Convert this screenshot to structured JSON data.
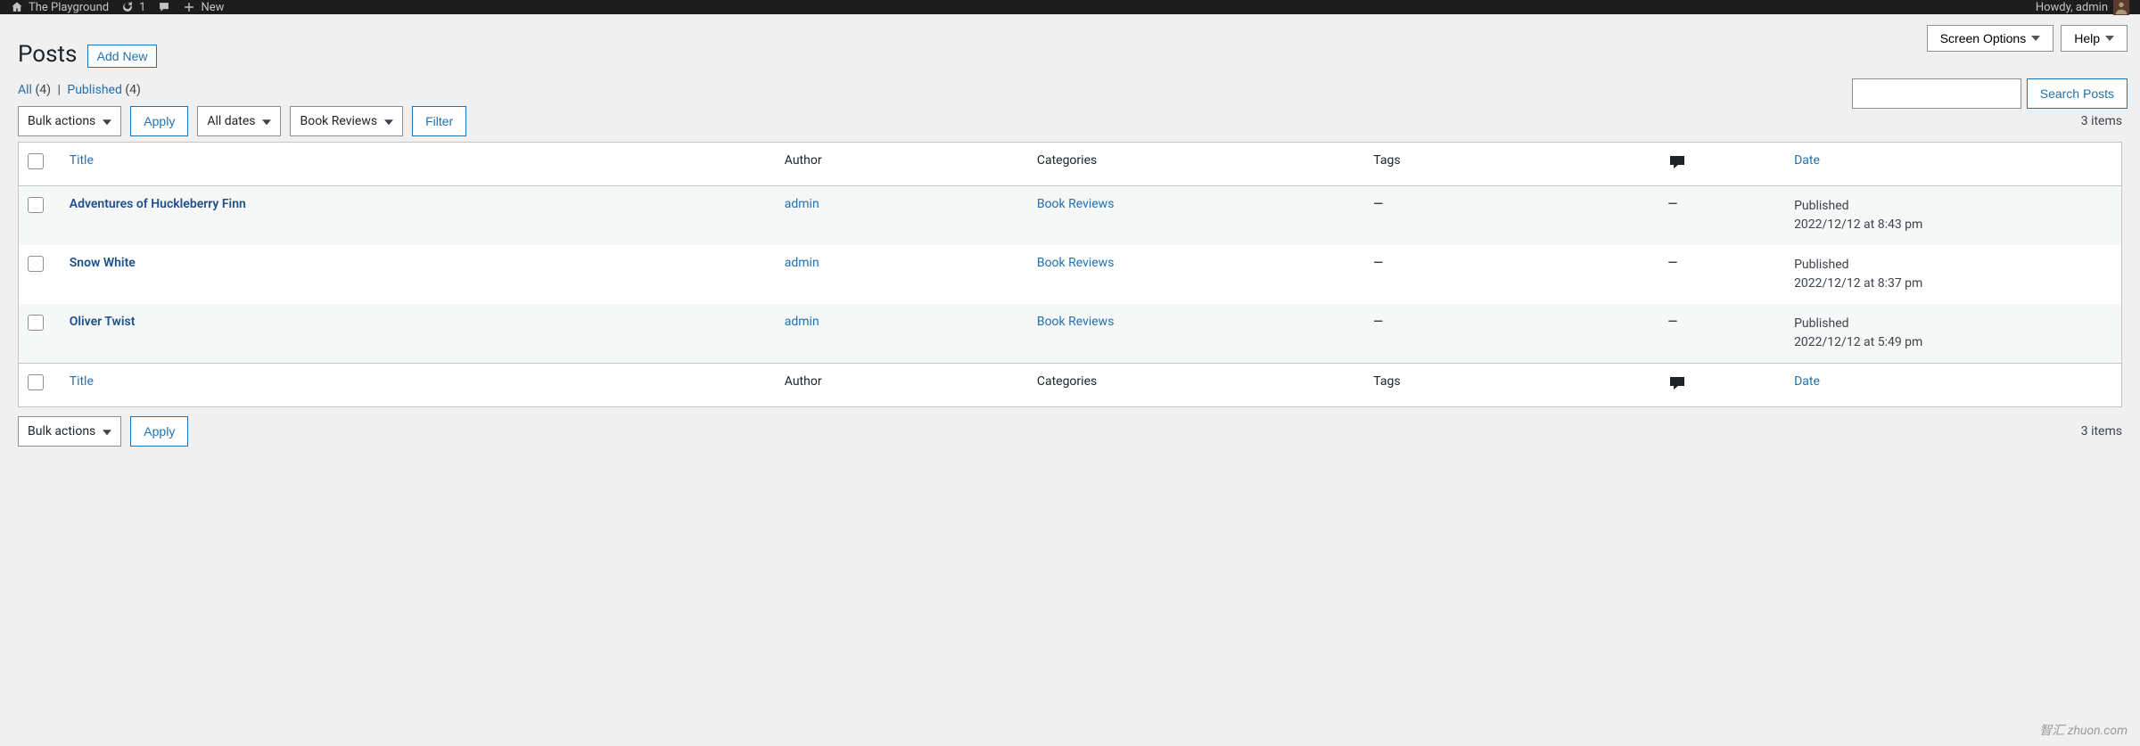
{
  "topbar": {
    "site_name": "The Playground",
    "updates": "1",
    "new_label": "New",
    "howdy": "Howdy, admin"
  },
  "screen_options": {
    "label": "Screen Options"
  },
  "help": {
    "label": "Help"
  },
  "heading": "Posts",
  "add_new": "Add New",
  "status_filters": {
    "all_label": "All",
    "all_count": "(4)",
    "published_label": "Published",
    "published_count": "(4)"
  },
  "search": {
    "button": "Search Posts"
  },
  "tablenav_top": {
    "bulk": "Bulk actions",
    "apply": "Apply",
    "dates": "All dates",
    "category": "Book Reviews",
    "filter": "Filter",
    "count": "3 items"
  },
  "tablenav_bottom": {
    "bulk": "Bulk actions",
    "apply": "Apply",
    "count": "3 items"
  },
  "columns": {
    "title": "Title",
    "author": "Author",
    "categories": "Categories",
    "tags": "Tags",
    "date": "Date"
  },
  "rows": [
    {
      "title": "Adventures of Huckleberry Finn",
      "author": "admin",
      "categories": "Book Reviews",
      "tags": "—",
      "comments": "—",
      "status": "Published",
      "date": "2022/12/12 at 8:43 pm"
    },
    {
      "title": "Snow White",
      "author": "admin",
      "categories": "Book Reviews",
      "tags": "—",
      "comments": "—",
      "status": "Published",
      "date": "2022/12/12 at 8:37 pm"
    },
    {
      "title": "Oliver Twist",
      "author": "admin",
      "categories": "Book Reviews",
      "tags": "—",
      "comments": "—",
      "status": "Published",
      "date": "2022/12/12 at 5:49 pm"
    }
  ],
  "watermark": "智汇 zhuon.com"
}
